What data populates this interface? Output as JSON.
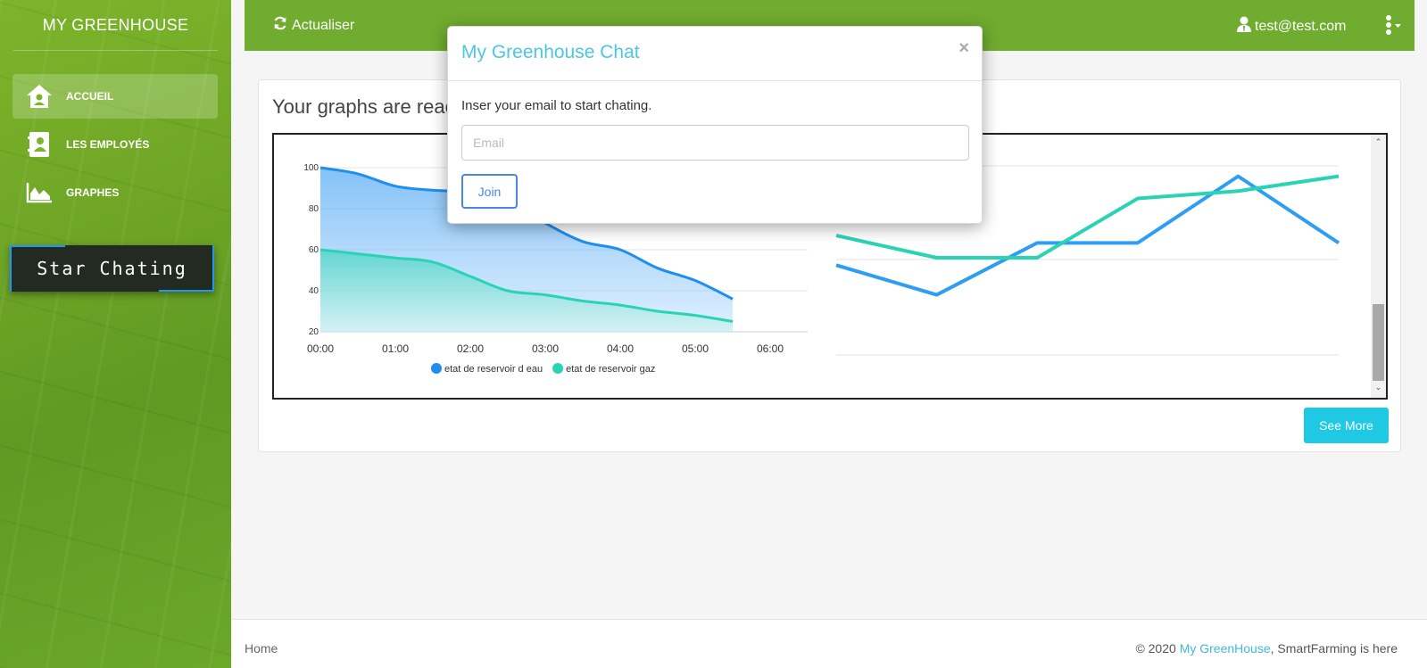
{
  "sidebar": {
    "brand": "MY GREENHOUSE",
    "items": [
      {
        "label": "ACCUEIL",
        "icon": "home-icon",
        "active": true
      },
      {
        "label": "LES EMPLOYÉS",
        "icon": "employee-card-icon",
        "active": false
      },
      {
        "label": "GRAPHES",
        "icon": "area-chart-icon",
        "active": false
      }
    ],
    "chat_button": "Star Chating"
  },
  "topbar": {
    "refresh_label": "Actualiser",
    "user_email": "test@test.com"
  },
  "card": {
    "title": "Your graphs are reac",
    "see_more": "See More"
  },
  "modal": {
    "title": "My Greenhouse Chat",
    "close": "×",
    "text": "Inser your email to start chating.",
    "email_placeholder": "Email",
    "join": "Join"
  },
  "footer": {
    "home": "Home",
    "copy_prefix": "© 2020 ",
    "copy_link": "My GreenHouse",
    "copy_suffix": ", SmartFarming is here"
  },
  "colors": {
    "sidebar_green": "#6ea526",
    "topbar_green": "#70ac2f",
    "water_series": "#1e8ff0",
    "gas_series": "#2bd3b5",
    "modal_title": "#4ec6e0",
    "see_more": "#1fc8e3"
  },
  "chart_data": [
    {
      "type": "area",
      "categories": [
        "00:00",
        "01:00",
        "02:00",
        "03:00",
        "04:00",
        "05:00",
        "06:00"
      ],
      "y_ticks": [
        100,
        80,
        60,
        40,
        20
      ],
      "ylim": [
        20,
        100
      ],
      "xlim": [
        0,
        6.5
      ],
      "series": [
        {
          "name": "etat de reservoir d eau",
          "color": "#1e8ff0",
          "x": [
            0,
            0.5,
            1,
            1.5,
            2,
            2.5,
            3,
            3.5,
            4,
            4.5,
            5,
            5.5
          ],
          "values": [
            100,
            97,
            91,
            89,
            88,
            84,
            73,
            64,
            60,
            51,
            45,
            36
          ]
        },
        {
          "name": "etat de reservoir gaz",
          "color": "#2bd3b5",
          "x": [
            0,
            0.5,
            1,
            1.5,
            2,
            2.5,
            3,
            3.5,
            4,
            4.5,
            5,
            5.5
          ],
          "values": [
            60,
            58,
            56,
            54,
            47,
            40,
            38,
            35,
            33,
            30,
            28,
            25
          ]
        }
      ],
      "legend": "bottom"
    },
    {
      "type": "line",
      "x": [
        0,
        1,
        2,
        3,
        4,
        5
      ],
      "series": [
        {
          "color": "#2e9ef0",
          "values": [
            52,
            48,
            55,
            55,
            64,
            55
          ]
        },
        {
          "color": "#2bd3b5",
          "values": [
            56,
            53,
            53,
            61,
            62,
            64
          ]
        }
      ],
      "ylim": [
        40,
        66
      ]
    }
  ]
}
